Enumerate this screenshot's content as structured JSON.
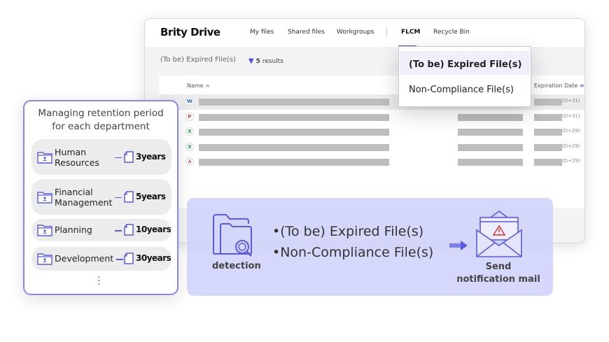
{
  "app": {
    "title": "Brity Drive",
    "nav": [
      "My files",
      "Shared files",
      "Workgroups",
      "FLCM",
      "Recycle Bin"
    ],
    "active_nav": "FLCM"
  },
  "list": {
    "breadcrumb": "(To be) Expired File(s)",
    "count": "5",
    "count_label": "results",
    "columns": {
      "name": "Name",
      "expiration": "Expiration Date"
    },
    "rows": [
      {
        "type": "W",
        "color": "#2b5fd9",
        "dday": "(D+31)"
      },
      {
        "type": "P",
        "color": "#e0412a",
        "dday": "(D+31)"
      },
      {
        "type": "X",
        "color": "#1e9a3c",
        "dday": "(D+29)"
      },
      {
        "type": "X",
        "color": "#1e9a3c",
        "dday": "(D+29)"
      },
      {
        "type": "pdf",
        "color": "#e0412a",
        "dday": "(D+29)"
      }
    ]
  },
  "dropdown": {
    "items": [
      "(To be) Expired File(s)",
      "Non-Compliance File(s)"
    ],
    "selected": "(To be) Expired File(s)"
  },
  "retention": {
    "title_1": "Managing retention period",
    "title_2": "for each department",
    "departments": [
      {
        "name_1": "Human",
        "name_2": "Resources",
        "years": "3years"
      },
      {
        "name_1": "Financial",
        "name_2": "Management",
        "years": "5years"
      },
      {
        "name_1": "Planning",
        "name_2": "",
        "years": "10years"
      },
      {
        "name_1": "Development",
        "name_2": "",
        "years": "30years"
      }
    ],
    "more": "⋮"
  },
  "flow": {
    "bullets": [
      "(To be) Expired File(s)",
      "Non-Compliance File(s)"
    ],
    "detection": "detection",
    "send_1": "Send",
    "send_2": "notification mail"
  },
  "colors": {
    "accent": "#5a5ae6",
    "panel": "#d6d8fb"
  }
}
